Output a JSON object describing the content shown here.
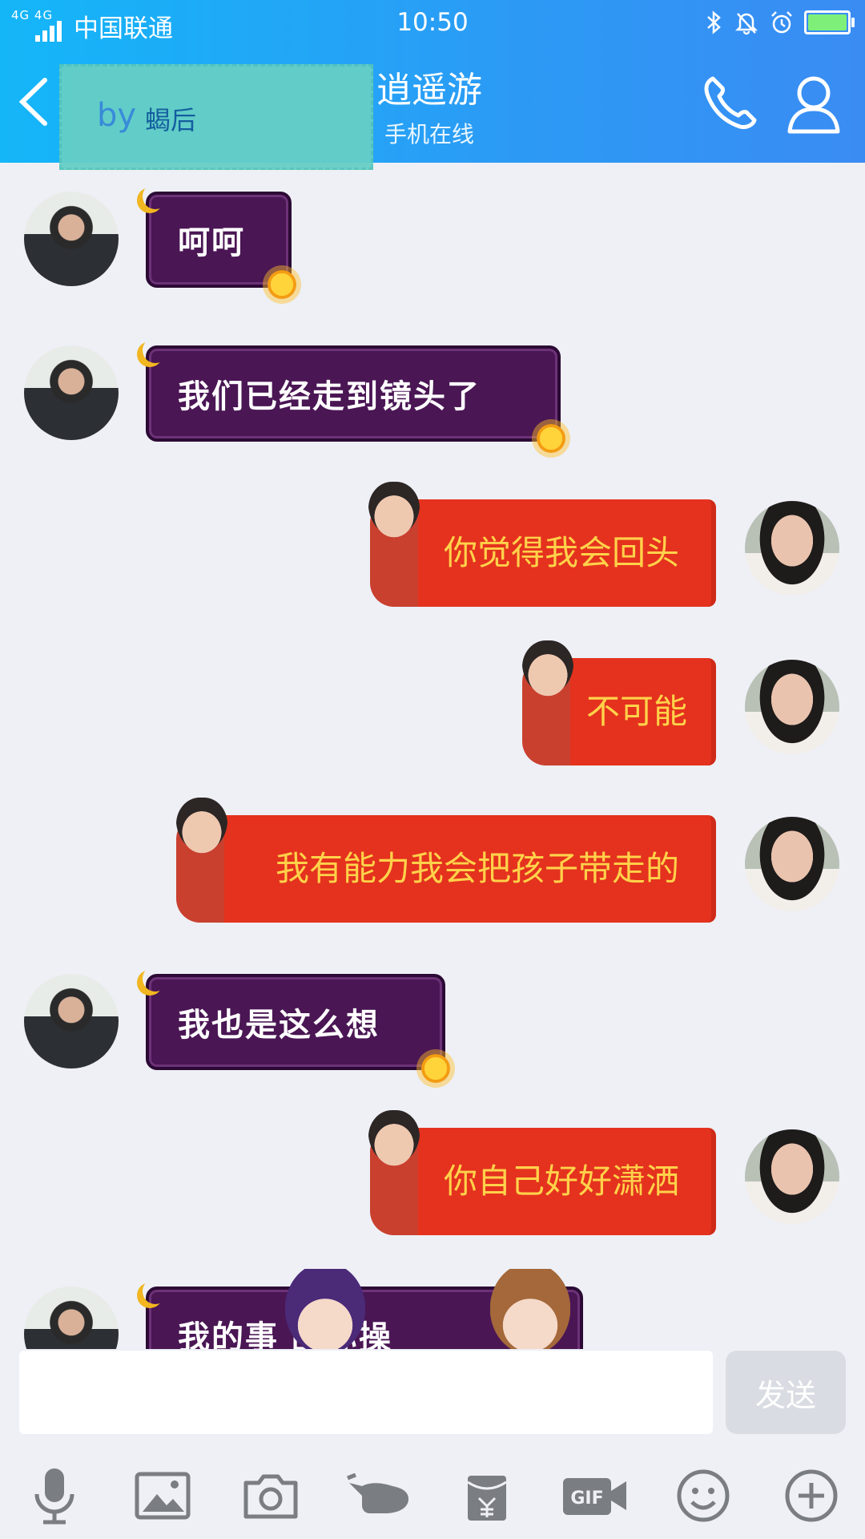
{
  "status": {
    "network": "4G 4G",
    "carrier": "中国联通",
    "time": "10:50"
  },
  "header": {
    "back_label": "",
    "masked_name": "by",
    "masked_name2": "蝎后",
    "title": "逍遥游",
    "subtitle": "手机在线"
  },
  "messages": [
    {
      "side": "left",
      "text": "呵呵"
    },
    {
      "side": "left",
      "text": "我们已经走到镜头了"
    },
    {
      "side": "right",
      "text": "你觉得我会回头"
    },
    {
      "side": "right",
      "text": "不可能"
    },
    {
      "side": "right",
      "text": "我有能力我会把孩子带走的"
    },
    {
      "side": "left",
      "text": "我也是这么想"
    },
    {
      "side": "right",
      "text": "你自己好好潇洒"
    },
    {
      "side": "left",
      "text": "我的事  围你操"
    }
  ],
  "composer": {
    "input_value": "",
    "send_label": "发送"
  },
  "toolbar": {
    "gif_label": "GIF"
  },
  "colors": {
    "header_start": "#14b6f8",
    "header_end": "#3a8cf3",
    "purple_bubble": "#4a1654",
    "red_bubble": "#e4321e",
    "red_text": "#ffd24a"
  }
}
